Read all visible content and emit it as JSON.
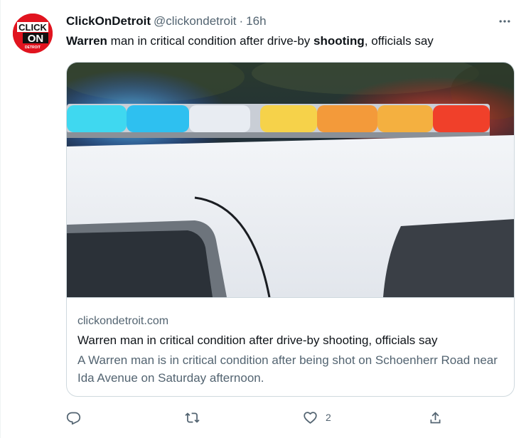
{
  "tweet": {
    "avatar": {
      "line1": "CLICK",
      "line2": "ON",
      "line3": "DETROIT"
    },
    "display_name": "ClickOnDetroit",
    "handle": "@clickondetroit",
    "separator": "·",
    "time": "16h",
    "more_label": "···",
    "text": {
      "w1": "Warren",
      "w2": " man in critical condition after drive-by ",
      "w3": "shooting",
      "w4": ", officials say"
    },
    "card": {
      "domain": "clickondetroit.com",
      "title": "Warren man in critical condition after drive-by shooting, officials say",
      "description": "A Warren man is in critical condition after being shot on Schoenherr Road near Ida Avenue on Saturday afternoon."
    },
    "actions": {
      "reply_count": "",
      "retweet_count": "",
      "like_count": "2"
    }
  },
  "icons": [
    "reply-icon",
    "retweet-icon",
    "like-icon",
    "share-icon",
    "more-icon"
  ],
  "colors": {
    "text": "#0f1419",
    "secondary": "#536471",
    "border": "#cfd9de",
    "brand_red": "#e1141f"
  }
}
